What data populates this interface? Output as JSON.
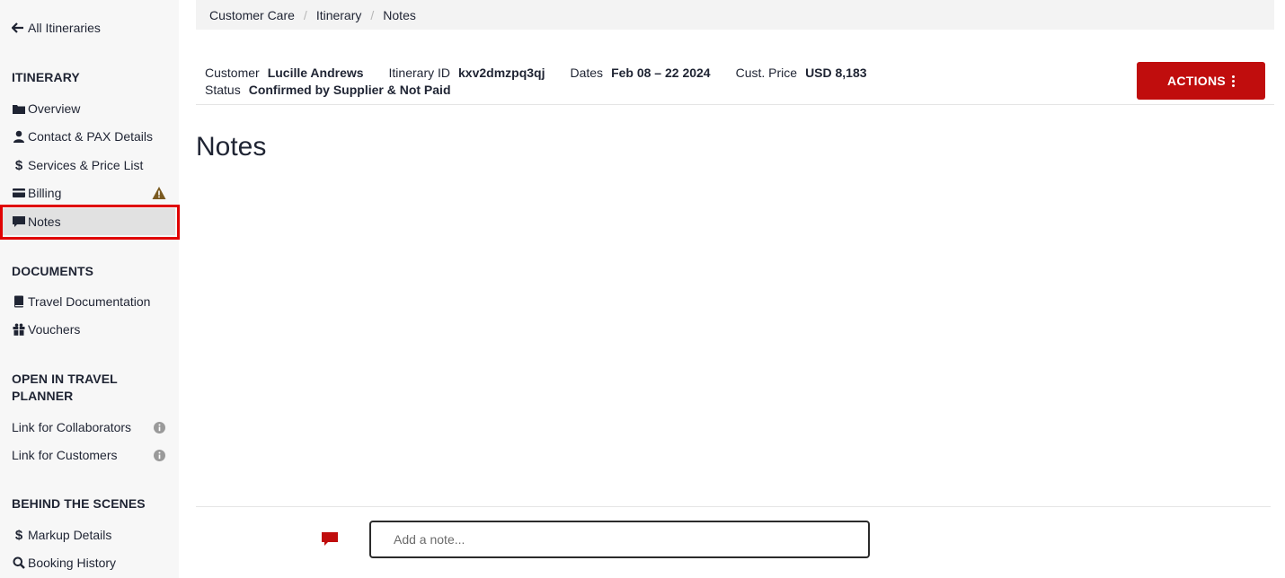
{
  "sidebar": {
    "back_label": "All Itineraries",
    "sections": {
      "itinerary": "ITINERARY",
      "documents": "DOCUMENTS",
      "open_in_planner": "OPEN IN TRAVEL PLANNER",
      "behind_scenes": "BEHIND THE SCENES"
    },
    "items": {
      "overview": "Overview",
      "contact": "Contact & PAX Details",
      "services": "Services & Price List",
      "billing": "Billing",
      "notes": "Notes",
      "travel_docs": "Travel Documentation",
      "vouchers": "Vouchers",
      "link_collab": "Link for Collaborators",
      "link_customers": "Link for Customers",
      "markup": "Markup Details",
      "booking_history": "Booking History"
    }
  },
  "breadcrumb": [
    "Customer Care",
    "Itinerary",
    "Notes"
  ],
  "header": {
    "customer_label": "Customer",
    "customer_value": "Lucille Andrews",
    "itinerary_id_label": "Itinerary ID",
    "itinerary_id_value": "kxv2dmzpq3qj",
    "dates_label": "Dates",
    "dates_value": "Feb 08 – 22 2024",
    "price_label": "Cust. Price",
    "price_value": "USD 8,183",
    "status_label": "Status",
    "status_value": "Confirmed by Supplier & Not Paid",
    "actions_label": "ACTIONS"
  },
  "main": {
    "title": "Notes",
    "note_placeholder": "Add a note..."
  },
  "colors": {
    "accent": "#c00d0d",
    "warning": "#7a5a20",
    "active_bg": "#e1e1e1"
  }
}
